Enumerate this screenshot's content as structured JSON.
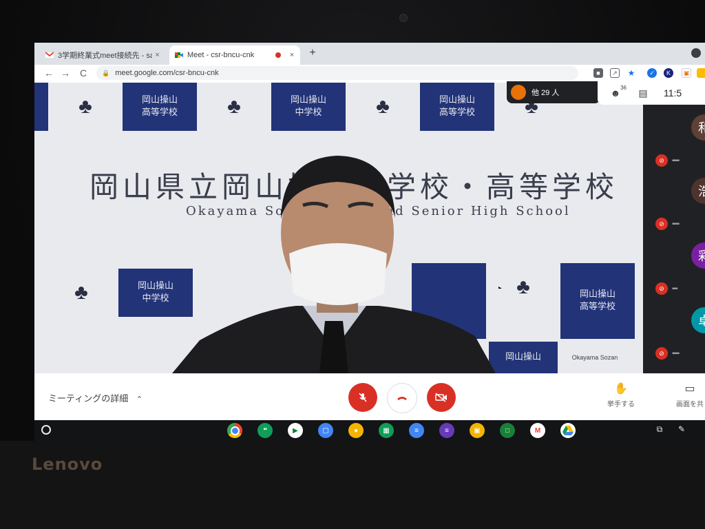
{
  "laptop": {
    "brand": "Lenovo"
  },
  "browser": {
    "tabs": [
      {
        "title": "3学期終業式meet接続先 - sato",
        "icon": "gmail-icon",
        "close": "×"
      },
      {
        "title": "Meet - csr-bncu-cnk",
        "icon": "meet-icon",
        "close": "×"
      }
    ],
    "new_tab": "+",
    "back": "←",
    "forward": "→",
    "reload": "C",
    "url": "meet.google.com/csr-bncu-cnk"
  },
  "stage": {
    "banner_blocks": [
      "岡山操山",
      "高等学校",
      "岡山操山",
      "中学校",
      "岡山操山",
      "高等学校",
      "岡山操山",
      "中学校",
      "岡山操山",
      "高等学校",
      "岡山操山"
    ],
    "school_title": "岡山県立岡山操山中学校・高等学校",
    "school_sub": "Okayama Sozan Junior and Senior High School",
    "banner_small": "Okayama Sozan"
  },
  "meet": {
    "others_count_label": "他 29 人",
    "participants_count": "36",
    "clock": "11:5",
    "participants": [
      {
        "initial": "和",
        "color": "#5d4037"
      },
      {
        "initial": "浩",
        "color": "#4e342e"
      },
      {
        "initial": "彩",
        "color": "#7b1fa2"
      },
      {
        "initial": "卓",
        "color": "#0097a7"
      }
    ],
    "controls": {
      "meeting_details": "ミーティングの詳細",
      "raise_hand": "挙手する",
      "present": "画面を共"
    }
  },
  "colors": {
    "red": "#d93025",
    "navy": "#223377"
  }
}
